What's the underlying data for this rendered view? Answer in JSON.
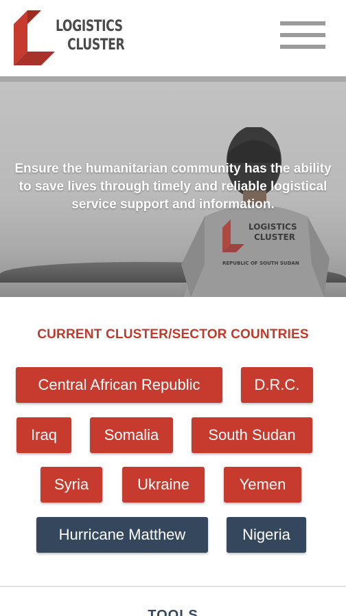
{
  "header": {
    "logo_line1": "LOGISTICS",
    "logo_line2": "CLUSTER",
    "menu_icon": "hamburger-menu-icon"
  },
  "hero": {
    "tagline": "Ensure the humanitarian community has the ability to save lives through timely and reliable logistical service support and information.",
    "shirt_line1": "LOGISTICS",
    "shirt_line2": "CLUSTER",
    "shirt_line3": "REPUBLIC OF SOUTH SUDAN"
  },
  "countries": {
    "title": "CURRENT CLUSTER/SECTOR COUNTRIES",
    "items": [
      {
        "label": "Central African Republic",
        "type": "cluster"
      },
      {
        "label": "D.R.C.",
        "type": "cluster"
      },
      {
        "label": "Iraq",
        "type": "cluster"
      },
      {
        "label": "Somalia",
        "type": "cluster"
      },
      {
        "label": "South Sudan",
        "type": "cluster"
      },
      {
        "label": "Syria",
        "type": "cluster"
      },
      {
        "label": "Ukraine",
        "type": "cluster"
      },
      {
        "label": "Yemen",
        "type": "cluster"
      },
      {
        "label": "Hurricane Matthew",
        "type": "sector"
      },
      {
        "label": "Nigeria",
        "type": "sector"
      }
    ]
  },
  "tools": {
    "title": "TOOLS"
  },
  "colors": {
    "brand_red": "#c73b2f",
    "sector_navy": "#34475c",
    "menu_gray": "#9b9b9b"
  }
}
